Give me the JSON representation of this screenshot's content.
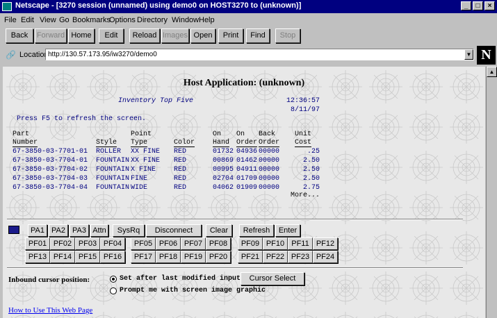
{
  "window": {
    "title": "Netscape - [3270 session (unnamed) using demo0 on HOST3270 to (unknown)]",
    "min": "_",
    "max": "□",
    "close": "×"
  },
  "menu": [
    "File",
    "Edit",
    "View",
    "Go",
    "Bookmarks",
    "Options",
    "Directory",
    "Window",
    "Help"
  ],
  "toolbar": [
    "Back",
    "Forward",
    "Home",
    "Edit",
    "Reload",
    "Images",
    "Open",
    "Print",
    "Find",
    "Stop"
  ],
  "location": {
    "label": "Location:",
    "url": "http://130.57.173.95/iw3270/demo0"
  },
  "brand_logo": "N",
  "host_title": "Host Application: (unknown)",
  "screen": {
    "subtitle": "Inventory Top Five",
    "time": "12:36:57",
    "date": "8/11/97",
    "hint": "Press F5 to refresh the screen.",
    "headers_top": [
      "Part",
      "Point",
      "On",
      "On",
      "Back",
      "Unit"
    ],
    "headers_bottom": [
      "Number",
      "Style",
      "Type",
      "Color",
      "Hand",
      "Order",
      "Order",
      "Cost"
    ],
    "rows": [
      [
        "67-3850-03-7701-01",
        "ROLLER",
        "XX FINE",
        "RED",
        "01732",
        "04936",
        "00000",
        ".25"
      ],
      [
        "67-3850-03-7704-01",
        "FOUNTAIN",
        "XX FINE",
        "RED",
        "00869",
        "01462",
        "00000",
        "2.50"
      ],
      [
        "67-3850-03-7704-02",
        "FOUNTAIN",
        "X FINE",
        "RED",
        "00995",
        "04911",
        "00000",
        "2.50"
      ],
      [
        "67-3850-03-7704-03",
        "FOUNTAIN",
        "FINE",
        "RED",
        "02704",
        "01709",
        "00000",
        "2.50"
      ],
      [
        "67-3850-03-7704-04",
        "FOUNTAIN",
        "WIDE",
        "RED",
        "04062",
        "01909",
        "00000",
        "2.75"
      ]
    ],
    "more": "More..."
  },
  "keys": {
    "row1": [
      "PA1",
      "PA2",
      "PA3",
      "Attn",
      "SysRq",
      "Disconnect",
      "Clear",
      "Refresh",
      "Enter"
    ],
    "pf_row1": [
      "PF01",
      "PF02",
      "PF03",
      "PF04",
      "PF05",
      "PF06",
      "PF07",
      "PF08",
      "PF09",
      "PF10",
      "PF11",
      "PF12"
    ],
    "pf_row2": [
      "PF13",
      "PF14",
      "PF15",
      "PF16",
      "PF17",
      "PF18",
      "PF19",
      "PF20",
      "PF21",
      "PF22",
      "PF23",
      "PF24"
    ]
  },
  "cursor": {
    "label": "Inbound cursor position:",
    "option1": "Set after last modified input",
    "option2": "Prompt me with screen image graphic",
    "button": "Cursor Select"
  },
  "help_link": "How to Use This Web Page"
}
